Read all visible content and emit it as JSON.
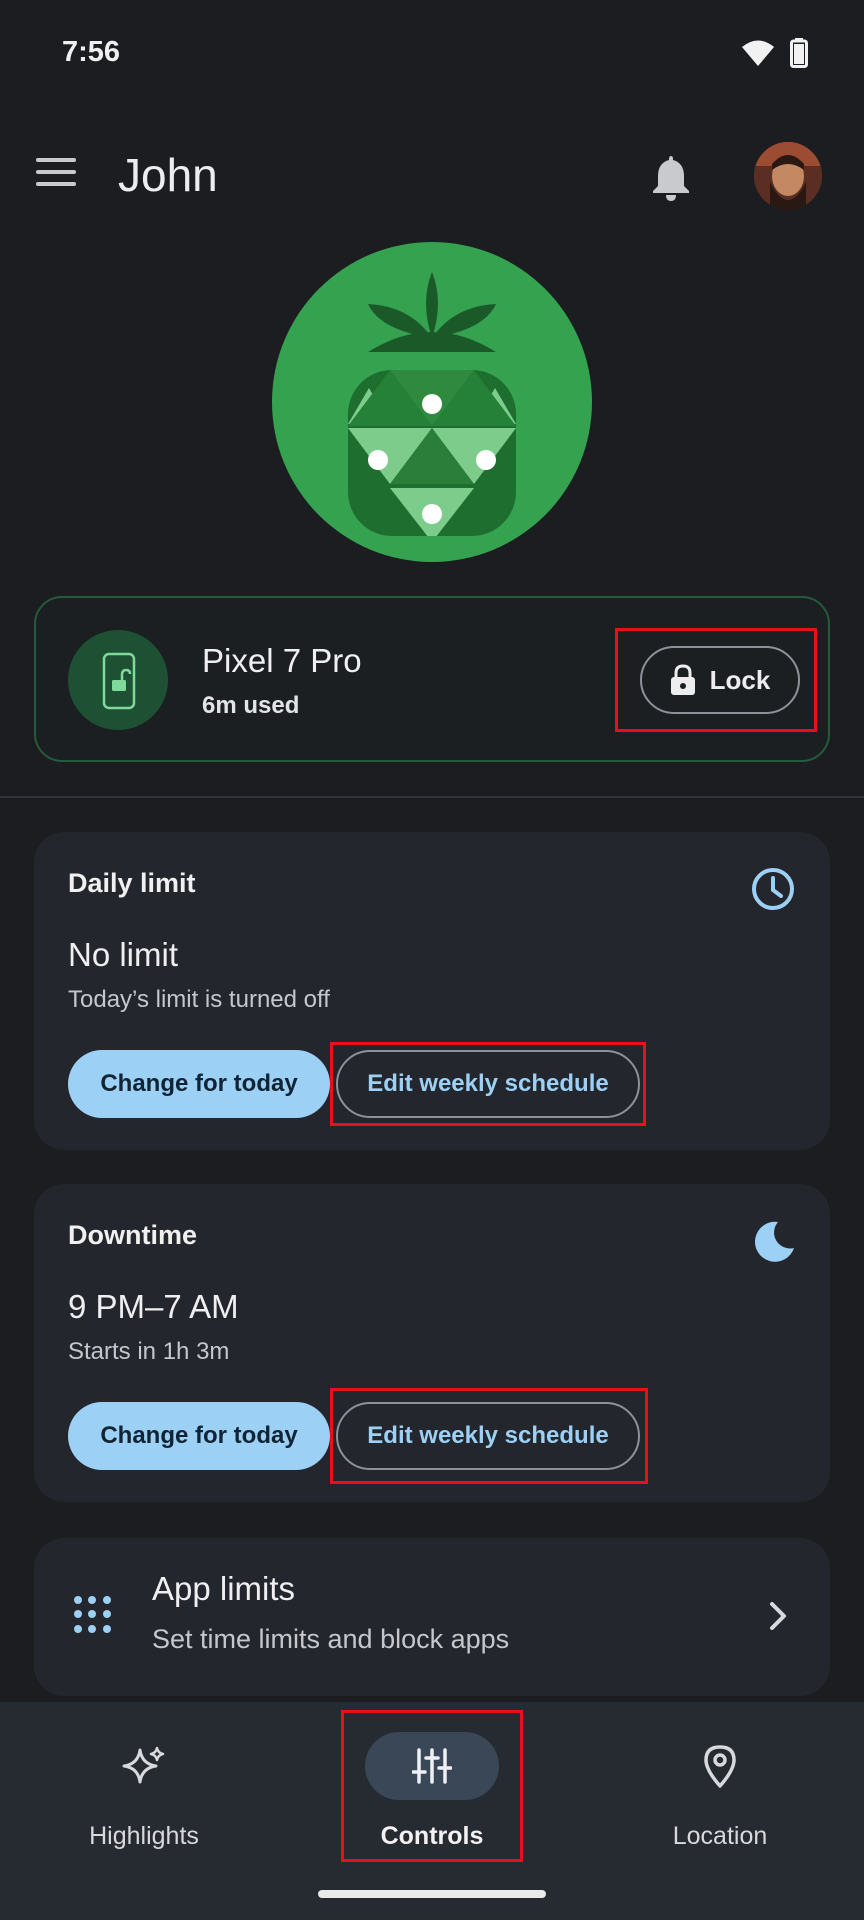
{
  "status_bar": {
    "time": "7:56",
    "wifi_icon": "wifi-icon",
    "battery_icon": "battery-icon"
  },
  "app_bar": {
    "title": "John",
    "menu_icon": "menu-icon",
    "bell_icon": "notification-bell-icon",
    "avatar": "avatar"
  },
  "hero": {
    "icon": "pineapple-illustration",
    "color": "#35a24f"
  },
  "device": {
    "name": "Pixel 7 Pro",
    "usage": "6m used",
    "lock_label": "Lock",
    "device_icon": "phone-unlocked-icon"
  },
  "daily_limit": {
    "label": "Daily limit",
    "value": "No limit",
    "subtitle": "Today’s limit is turned off",
    "primary_button": "Change for today",
    "secondary_button": "Edit weekly schedule",
    "icon": "clock-icon"
  },
  "downtime": {
    "label": "Downtime",
    "value": "9 PM–7 AM",
    "subtitle": "Starts in 1h 3m",
    "primary_button": "Change for today",
    "secondary_button": "Edit weekly schedule",
    "icon": "moon-icon"
  },
  "app_limits": {
    "title": "App limits",
    "subtitle": "Set time limits and block apps",
    "icon": "apps-grid-icon"
  },
  "bottom_nav": {
    "items": [
      {
        "label": "Highlights",
        "icon": "sparkle-icon",
        "active": false
      },
      {
        "label": "Controls",
        "icon": "sliders-icon",
        "active": true
      },
      {
        "label": "Location",
        "icon": "location-pin-icon",
        "active": false
      }
    ]
  },
  "colors": {
    "accent": "#9dd0f5",
    "background": "#1b1d21",
    "card": "#23262c",
    "highlight": "#e8101a"
  }
}
